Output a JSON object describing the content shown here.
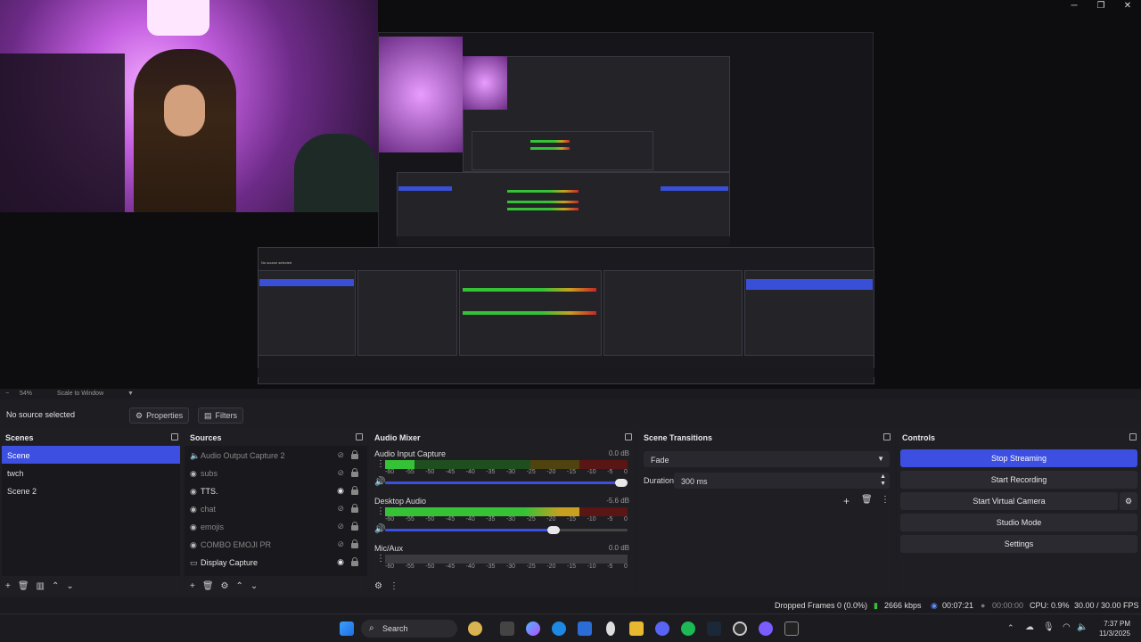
{
  "preview": {
    "zoom_level": "54%",
    "scale_mode": "Scale to Window"
  },
  "source_toolbar": {
    "no_source": "No source selected",
    "properties": "Properties",
    "filters": "Filters"
  },
  "scenes": {
    "title": "Scenes",
    "items": [
      "Scene",
      "twch",
      "Scene 2"
    ],
    "selected_index": 0
  },
  "sources": {
    "title": "Sources",
    "items": [
      {
        "label": "Audio Output Capture 2",
        "icon": "speaker-icon",
        "visible": false
      },
      {
        "label": "subs",
        "icon": "globe-icon",
        "visible": false
      },
      {
        "label": "TTS.",
        "icon": "globe-icon",
        "visible": true
      },
      {
        "label": "chat",
        "icon": "globe-icon",
        "visible": false
      },
      {
        "label": "emojis",
        "icon": "globe-icon",
        "visible": false
      },
      {
        "label": "COMBO EMOJI PR",
        "icon": "globe-icon",
        "visible": false
      },
      {
        "label": "Display Capture",
        "icon": "monitor-icon",
        "visible": true
      }
    ]
  },
  "audio_mixer": {
    "title": "Audio Mixer",
    "ticks": [
      "-60",
      "-55",
      "-50",
      "-45",
      "-40",
      "-35",
      "-30",
      "-25",
      "-20",
      "-15",
      "-10",
      "-5",
      "0"
    ],
    "channels": [
      {
        "name": "Audio Input Capture",
        "db": "0.0 dB",
        "level": 0.12,
        "volume": 1.0
      },
      {
        "name": "Desktop Audio",
        "db": "-5.6 dB",
        "level": 0.8,
        "volume": 0.72
      },
      {
        "name": "Mic/Aux",
        "db": "0.0 dB",
        "level": 0.0,
        "volume": 1.0
      }
    ]
  },
  "transitions": {
    "title": "Scene Transitions",
    "selected": "Fade",
    "duration_label": "Duration",
    "duration_value": "300 ms"
  },
  "controls": {
    "title": "Controls",
    "stop_streaming": "Stop Streaming",
    "start_recording": "Start Recording",
    "start_virtual_camera": "Start Virtual Camera",
    "studio_mode": "Studio Mode",
    "settings": "Settings"
  },
  "status": {
    "dropped_frames": "Dropped Frames 0 (0.0%)",
    "bitrate": "2666 kbps",
    "stream_time": "00:07:21",
    "rec_time": "00:00:00",
    "cpu": "CPU: 0.9%",
    "fps": "30.00 / 30.00 FPS"
  },
  "taskbar": {
    "search_label": "Search",
    "time": "7:37 PM",
    "date": "11/3/2025"
  },
  "colors": {
    "accent": "#3c4fe0",
    "meter_green": "#36c236",
    "meter_yellow": "#c8a020",
    "meter_red": "#c82828"
  }
}
